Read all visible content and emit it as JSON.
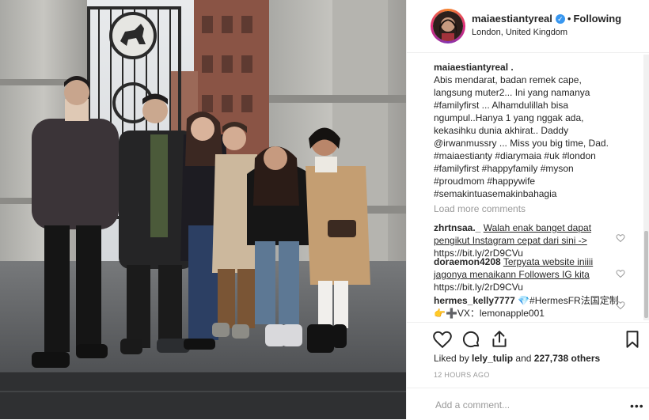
{
  "post": {
    "username": "maiaestiantyreal",
    "verified_badge": "✓",
    "separator": "•",
    "follow_status": "Following",
    "location": "London, United Kingdom",
    "caption": {
      "username": "maiaestiantyreal .",
      "text": "Abis mendarat, badan remek cape,\nlangsung muter2... Ini yang namanya\n#familyfirst ... Alhamdulillah bisa\nngumpul..Hanya 1 yang nggak ada,\nkekasihku dunia akhirat.. Daddy\n@irwanmussry ... Miss you big time, Dad.\n#maiaestianty #diarymaia #uk #london\n#familyfirst #happyfamily #myson\n#proudmom #happywife\n#semakintuasemakinbahagia"
    },
    "load_more": "Load more comments",
    "comments": [
      {
        "user": "zhrtnsaa._",
        "text": "Walah enak banget dapat pengikut Instagram cepat dari sini ->",
        "link": "https://bit.ly/2rD9CVu"
      },
      {
        "user": "doraemon4208",
        "text": "Terpyata website iniiii jagonya menaikann Followers IG kita",
        "link": "https://bit.ly/2rD9CVu"
      },
      {
        "user": "hermes_kelly7777",
        "text": "💎#HermesFR法国定制👉➕VX：lemonapple001"
      }
    ],
    "likes": {
      "prefix": "Liked by",
      "user": "lely_tulip",
      "middle": "and",
      "count": "227,738 others"
    },
    "timestamp": "12 HOURS AGO",
    "add_comment_placeholder": "Add a comment...",
    "more_label": "•••"
  },
  "icons": {
    "like": "heart-icon",
    "comment": "comment-bubble-icon",
    "share": "share-icon",
    "save": "bookmark-icon",
    "verified": "verified-badge-icon"
  },
  "colors": {
    "verified": "#3897f0",
    "muted": "#999999",
    "text": "#262626",
    "border": "#efefef"
  }
}
